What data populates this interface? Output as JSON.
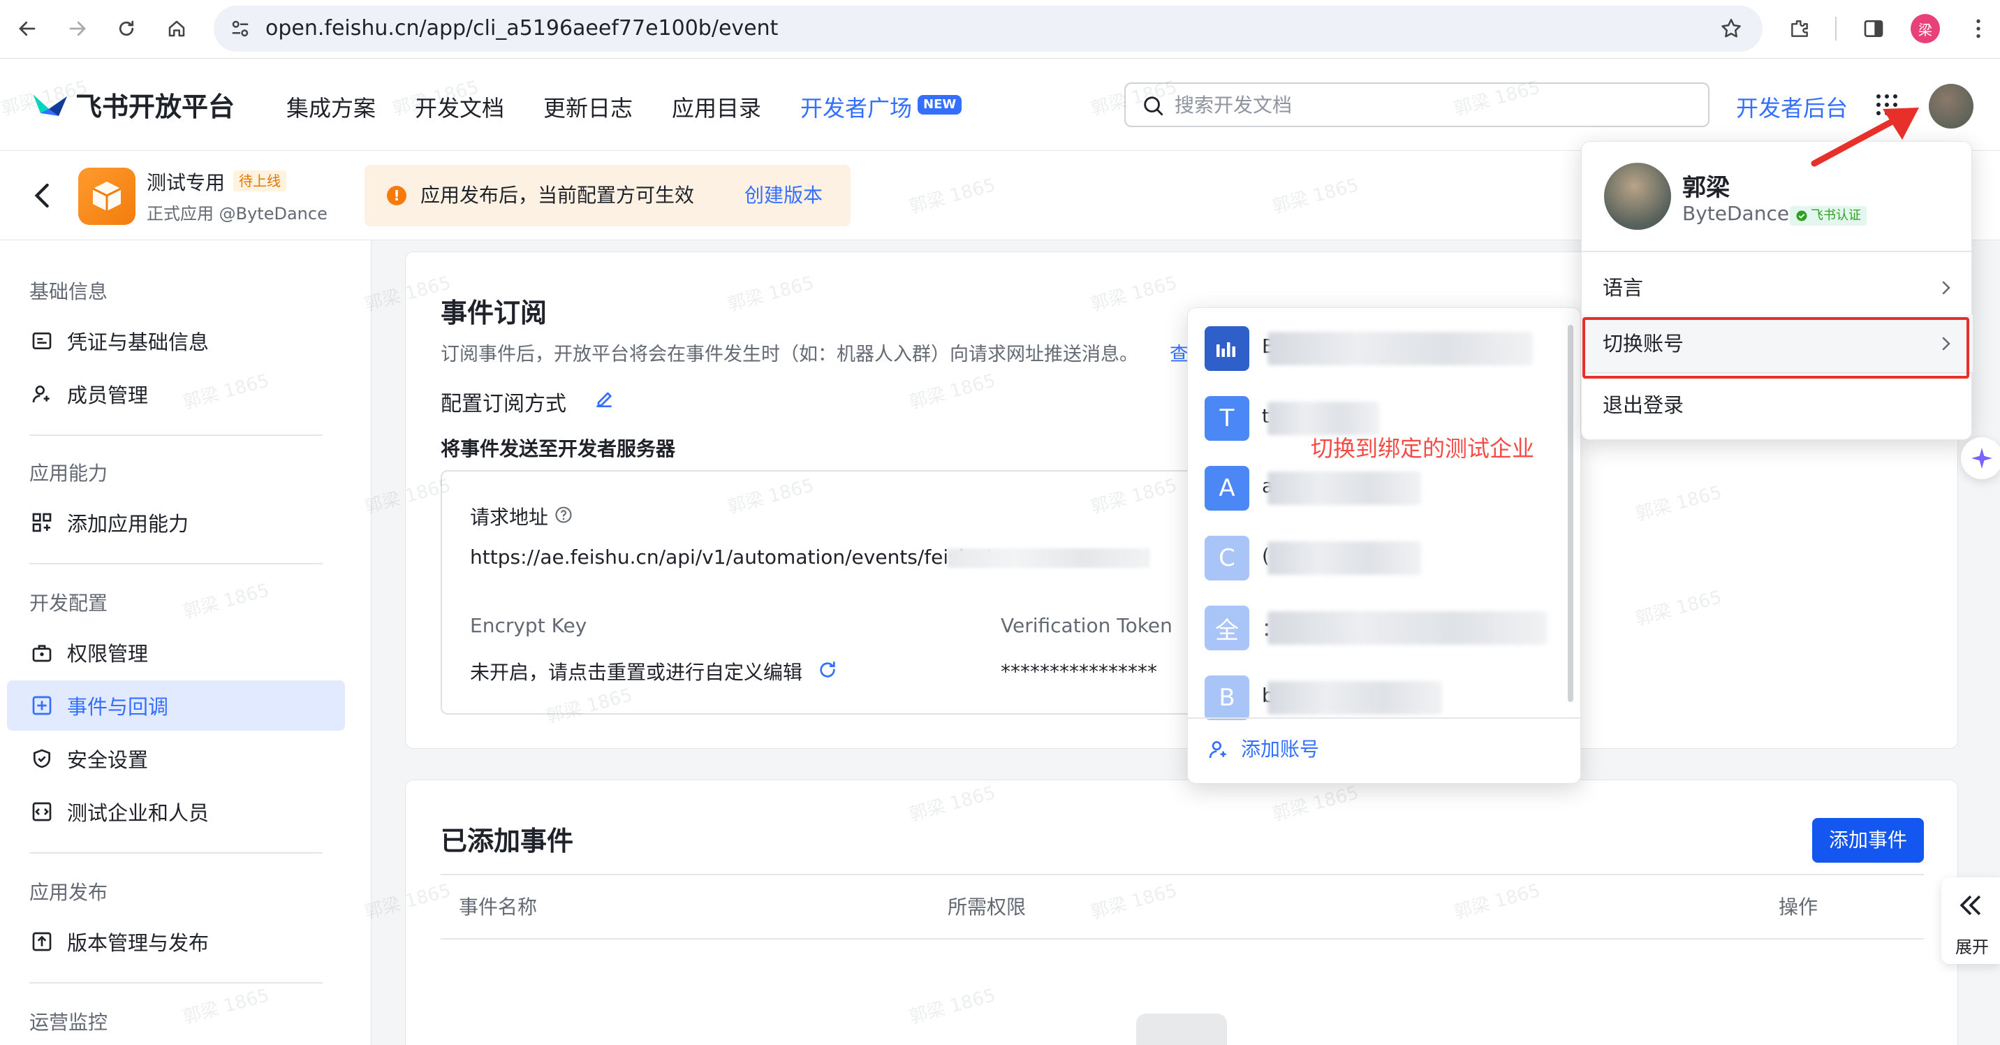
{
  "browser": {
    "url": "open.feishu.cn/app/cli_a5196aeef77e100b/event",
    "profile_initial": "梁"
  },
  "header": {
    "brand": "飞书开放平台",
    "menu": [
      "集成方案",
      "开发文档",
      "更新日志",
      "应用目录",
      "开发者广场"
    ],
    "new_badge": "NEW",
    "search_placeholder": "搜索开发文档",
    "console_link": "开发者后台"
  },
  "app": {
    "name": "测试专用",
    "status": "待上线",
    "subtitle": "正式应用 @ByteDance",
    "notice": "应用发布后，当前配置方可生效",
    "notice_link": "创建版本"
  },
  "sidebar": {
    "sections": [
      {
        "title": "基础信息",
        "items": [
          {
            "label": "凭证与基础信息",
            "icon": "credential-icon"
          },
          {
            "label": "成员管理",
            "icon": "member-icon"
          }
        ]
      },
      {
        "title": "应用能力",
        "items": [
          {
            "label": "添加应用能力",
            "icon": "add-capability-icon"
          }
        ]
      },
      {
        "title": "开发配置",
        "items": [
          {
            "label": "权限管理",
            "icon": "permission-icon"
          },
          {
            "label": "事件与回调",
            "icon": "event-icon",
            "active": true
          },
          {
            "label": "安全设置",
            "icon": "shield-icon"
          },
          {
            "label": "测试企业和人员",
            "icon": "code-icon"
          }
        ]
      },
      {
        "title": "应用发布",
        "items": [
          {
            "label": "版本管理与发布",
            "icon": "publish-icon"
          }
        ]
      },
      {
        "title": "运营监控",
        "items": []
      }
    ]
  },
  "event_subscription": {
    "title": "事件订阅",
    "description": "订阅事件后，开放平台将会在事件发生时（如：机器人入群）向请求网址推送消息。",
    "description_link": "查",
    "config_label": "配置订阅方式",
    "mode": "将事件发送至开发者服务器",
    "request_url_label": "请求地址",
    "request_url": "https://ae.feishu.cn/api/v1/automation/events/feishu/",
    "encrypt_key_label": "Encrypt Key",
    "encrypt_key_value": "未开启，请点击重置或进行自定义编辑",
    "verification_token_label": "Verification Token",
    "verification_token_value": "****************"
  },
  "added_events": {
    "title": "已添加事件",
    "add_button": "添加事件",
    "columns": [
      "事件名称",
      "所需权限",
      "操作"
    ]
  },
  "account_popup": {
    "accounts": [
      {
        "initial": "",
        "color": "#2f5fc9",
        "letter": "B"
      },
      {
        "initial": "T",
        "color": "#4c88f5",
        "letter": "t"
      },
      {
        "initial": "A",
        "color": "#4c88f5",
        "letter": "a"
      },
      {
        "initial": "C",
        "color": "#a9c4f7",
        "letter": "("
      },
      {
        "initial": "全",
        "color": "#a9c4f7",
        "letter": "："
      },
      {
        "initial": "B",
        "color": "#a9c4f7",
        "letter": "b"
      }
    ],
    "annotation": "切换到绑定的测试企业",
    "add_account": "添加账号"
  },
  "user_menu": {
    "name": "郭梁",
    "org": "ByteDance",
    "verified": "飞书认证",
    "items": [
      "语言",
      "切换账号",
      "退出登录"
    ]
  },
  "side_widgets": {
    "expand_label": "展开"
  },
  "watermark": "郭梁 1865",
  "colors": {
    "primary": "#3370ff",
    "active_bg": "#e1eaff",
    "annotation_red": "#e8302b",
    "warning": "#f77a0c"
  }
}
